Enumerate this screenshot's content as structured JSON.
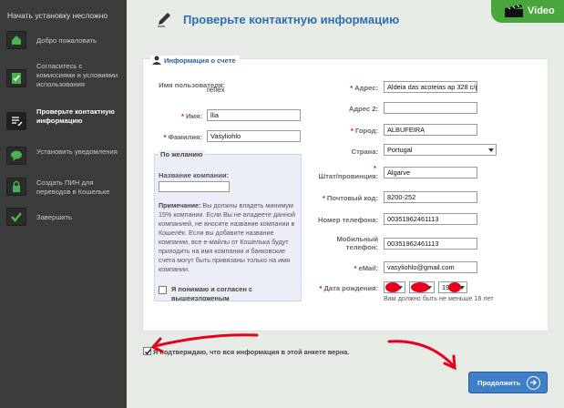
{
  "sidebar": {
    "title": "Начать установку несложно",
    "items": [
      {
        "label": "Добро пожаловать"
      },
      {
        "label": "Согласитесь с комиссиями и условиями использования"
      },
      {
        "label": "Проверьте контактную информацию"
      },
      {
        "label": "Установить уведомления"
      },
      {
        "label": "Создать ПИН для переводов в Кошельке"
      },
      {
        "label": "Завершить"
      }
    ]
  },
  "header": {
    "title": "Проверьте контактную информацию",
    "video_label": "Video"
  },
  "account": {
    "section_title": "Информация о счете",
    "username_label": "Имя пользователя:",
    "username_value": "reflex",
    "firstname_label": "Имя:",
    "firstname_value": "llia",
    "lastname_label": "Фамилия:",
    "lastname_value": "Vasyliohlo"
  },
  "optional": {
    "title": "По желанию",
    "company_label": "Название компании:",
    "company_value": "",
    "note_bold": "Примечание:",
    "note_text": " Вы должны владеть минимум 15% компании. Если Вы не владеете данной компанией, не вносите название компании в Кошелёк. Если вы добавите название компании, все е-майлы от Кошелька будут приходить на имя компании и банковские счета могут быть привязаны только на имя компании.",
    "agree_label": "Я понимаю и согласен с вышеизложеным"
  },
  "address": {
    "address_label": "Адрес:",
    "address_value": "Aldeia das acoteias ap 328 c/p",
    "address2_label": "Адрес 2:",
    "address2_value": "",
    "city_label": "Город:",
    "city_value": "ALBUFEIRA",
    "country_label": "Страна:",
    "country_value": "Portugal",
    "state_label": "Штат/провинция:",
    "state_value": "Algarve",
    "postal_label": "Почтовый код:",
    "postal_value": "8200-252",
    "phone_label": "Номер телефона:",
    "phone_value": "00351962461113",
    "mobile_label": "Мобильный телефон:",
    "mobile_value": "00351962461113",
    "email_label": "eMail:",
    "email_value": "vasyliohlo@gmail.com",
    "dob_label": "Дата рождения:",
    "dob_year_partial": "19",
    "age_note": "Вам должно быть не меньше 18 лет"
  },
  "footer": {
    "confirm_label": "Я подтверждаю, что вся информация в этой анкете верна.",
    "continue_label": "Продолжить"
  },
  "colors": {
    "accent": "#2f6fad",
    "sidebar_bg": "#3b3d3c",
    "video_tab": "#49a63d",
    "required": "#d01010",
    "annotation_red": "#e8001c"
  }
}
